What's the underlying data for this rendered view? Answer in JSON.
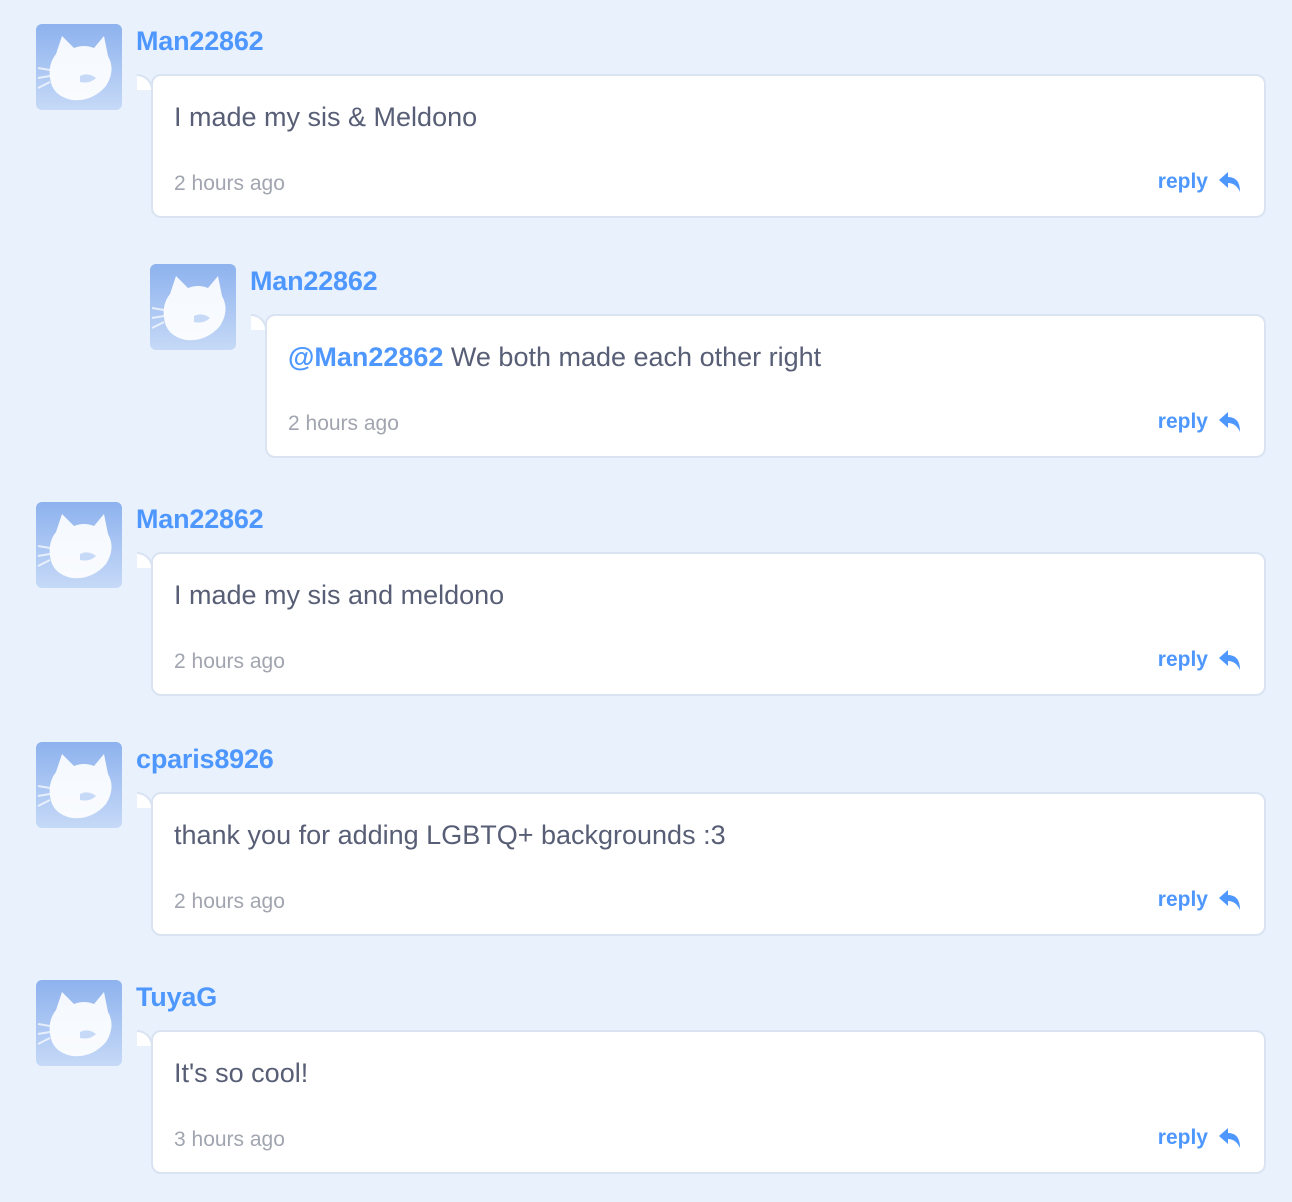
{
  "comments": [
    {
      "username": "Man22862",
      "text": "I made my sis & Meldono",
      "time": "2 hours ago",
      "reply_label": "reply",
      "is_reply": false
    },
    {
      "username": "Man22862",
      "mention": "@Man22862",
      "text": " We both made each other right",
      "time": "2 hours ago",
      "reply_label": "reply",
      "is_reply": true
    },
    {
      "username": "Man22862",
      "text": "I made my sis and meldono",
      "time": "2 hours ago",
      "reply_label": "reply",
      "is_reply": false
    },
    {
      "username": "cparis8926",
      "text": "thank you for adding LGBTQ+ backgrounds :3",
      "time": "2 hours ago",
      "reply_label": "reply",
      "is_reply": false
    },
    {
      "username": "TuyaG",
      "text": "It's so cool!",
      "time": "3 hours ago",
      "reply_label": "reply",
      "is_reply": false
    }
  ],
  "colors": {
    "page_background": "#e9f1fc",
    "username": "#4d97ff",
    "body_text": "#575e75",
    "timestamp": "#a1a5af",
    "bubble_border": "#d9e3f2"
  },
  "icons": {
    "avatar": "default-cat-avatar-icon",
    "reply": "reply-arrow-icon"
  }
}
